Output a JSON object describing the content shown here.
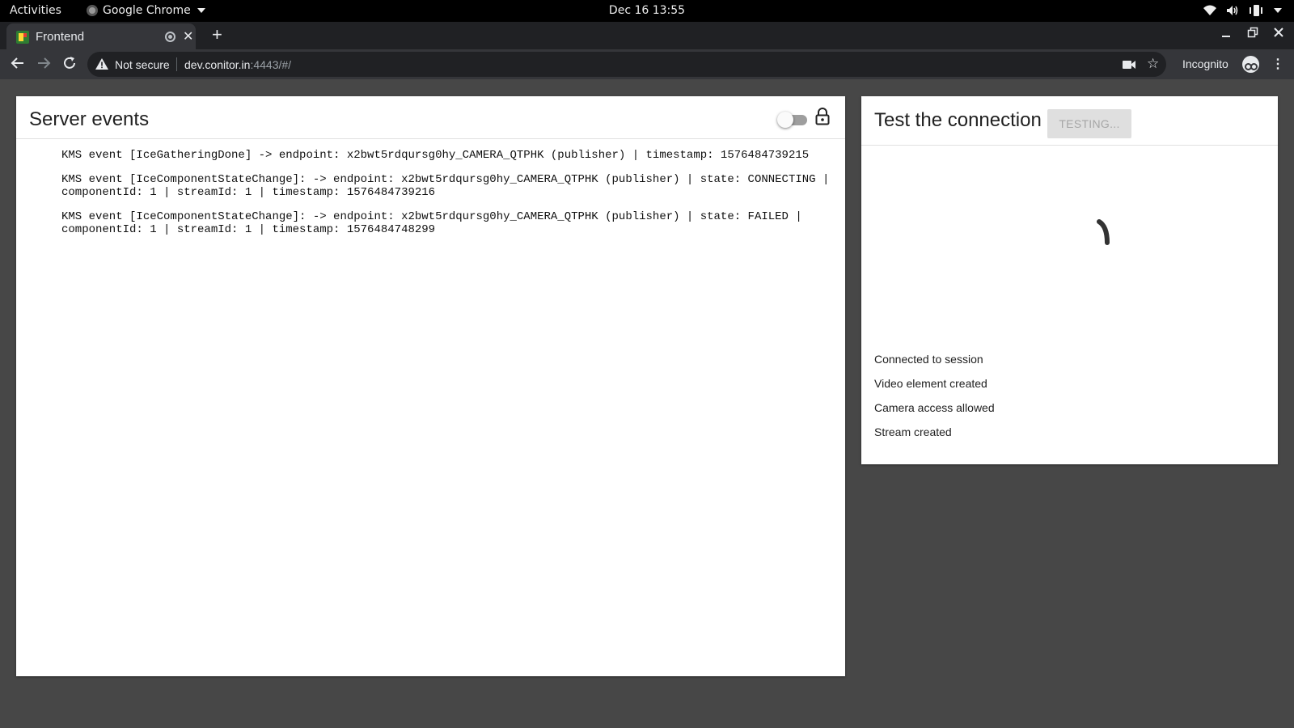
{
  "system_bar": {
    "activities": "Activities",
    "app_name": "Google Chrome",
    "clock": "Dec 16  13:55"
  },
  "browser": {
    "tab": {
      "title": "Frontend"
    },
    "new_tab": "+",
    "address": {
      "security_label": "Not secure",
      "host": "dev.conitor.in",
      "rest": ":4443/#/"
    },
    "profile_label": "Incognito"
  },
  "server_events": {
    "title": "Server events",
    "toggle_on": false,
    "events": [
      "KMS event [IceGatheringDone] -> endpoint: x2bwt5rdqursg0hy_CAMERA_QTPHK (publisher) | timestamp: 1576484739215",
      "KMS event [IceComponentStateChange]: -> endpoint: x2bwt5rdqursg0hy_CAMERA_QTPHK (publisher) | state: CONNECTING | componentId: 1 | streamId: 1 | timestamp: 1576484739216",
      "KMS event [IceComponentStateChange]: -> endpoint: x2bwt5rdqursg0hy_CAMERA_QTPHK (publisher) | state: FAILED | componentId: 1 | streamId: 1 | timestamp: 1576484748299"
    ]
  },
  "test_connection": {
    "title": "Test the connection",
    "button_label": "TESTING...",
    "steps": [
      "Connected to session",
      "Video element created",
      "Camera access allowed",
      "Stream created"
    ]
  },
  "colors": {
    "page_bg": "#474747",
    "card_bg": "#ffffff",
    "tab_strip": "#202124",
    "toolbar": "#35363a"
  }
}
